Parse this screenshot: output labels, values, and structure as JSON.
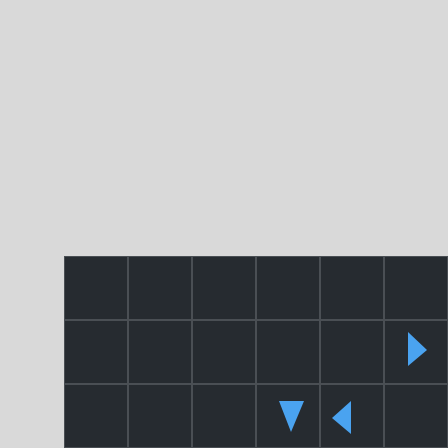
{
  "board": {
    "rows": 3,
    "cols": 6,
    "cell_color": "#262b30",
    "grid_line_color": "#4a4f54",
    "background_color": "#d9d9d9"
  },
  "pieces": [
    {
      "row": 1,
      "col": 5,
      "direction": "right",
      "color": "#4aa3f0",
      "icon": "arrow-right-icon"
    },
    {
      "row": 2,
      "col": 3,
      "direction": "down",
      "color": "#4aa3f0",
      "icon": "arrow-down-icon"
    },
    {
      "row": 2,
      "col": 4,
      "direction": "left",
      "color": "#4aa3f0",
      "icon": "arrow-left-icon"
    }
  ]
}
